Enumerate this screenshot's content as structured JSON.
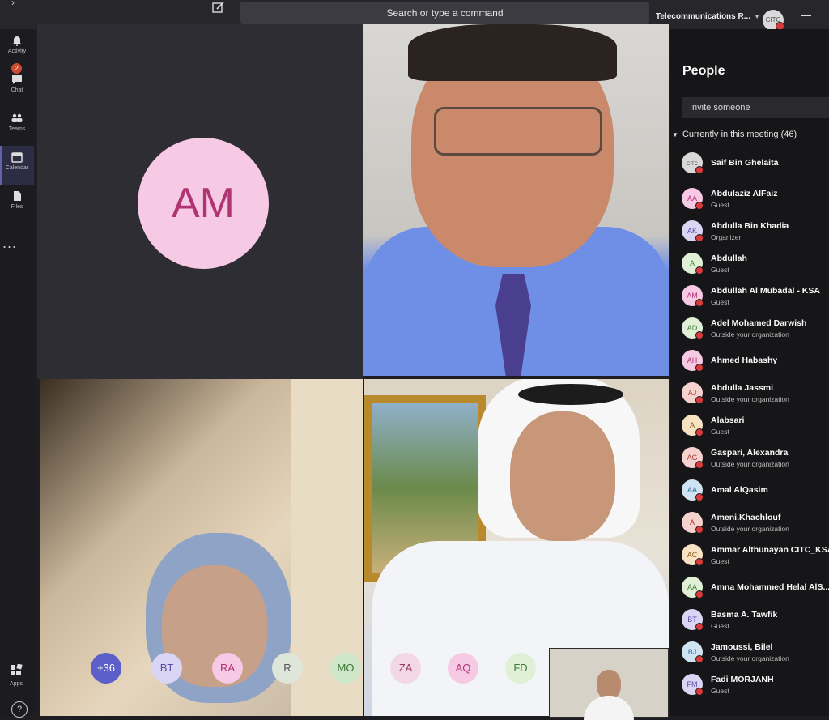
{
  "topbar": {
    "search_placeholder": "Search or type a command",
    "tenant": "Telecommunications R...",
    "me_initials": "CITC"
  },
  "rail": {
    "items": [
      {
        "label": "Activity"
      },
      {
        "label": "Chat",
        "badge": "2"
      },
      {
        "label": "Teams"
      },
      {
        "label": "Calendar"
      },
      {
        "label": "Files"
      }
    ],
    "more": "...",
    "apps": "Apps",
    "help": "?"
  },
  "stage": {
    "am_initials": "AM"
  },
  "roster": [
    {
      "initials": "+36",
      "bg": "#5b5fc7",
      "fg": "#ffffff"
    },
    {
      "initials": "BT",
      "bg": "#d9d5f3",
      "fg": "#5b4ba8"
    },
    {
      "initials": "RA",
      "bg": "#f6c9e4",
      "fg": "#b03473"
    },
    {
      "initials": "R",
      "bg": "#dde6d8",
      "fg": "#555555"
    },
    {
      "initials": "MO",
      "bg": "#cfe6c9",
      "fg": "#3d7a36"
    },
    {
      "initials": "ZA",
      "bg": "#f3d7e6",
      "fg": "#9b3a6a"
    },
    {
      "initials": "AQ",
      "bg": "#f6c9e4",
      "fg": "#b03473"
    },
    {
      "initials": "FD",
      "bg": "#dff0d6",
      "fg": "#3d7a36"
    }
  ],
  "people": {
    "title": "People",
    "invite_placeholder": "Invite someone",
    "section": "Currently in this meeting (46)",
    "list": [
      {
        "initials": "CITC",
        "name": "Saif Bin Ghelaita",
        "role": "",
        "bg": "#d9d9d9",
        "fg": "#555555"
      },
      {
        "initials": "AA",
        "name": "Abdulaziz AlFaiz",
        "role": "Guest",
        "bg": "#f6c9e4",
        "fg": "#b03473"
      },
      {
        "initials": "AK",
        "name": "Abdulla Bin Khadia",
        "role": "Organizer",
        "bg": "#d9d5f3",
        "fg": "#5b4ba8"
      },
      {
        "initials": "A",
        "name": "Abdullah",
        "role": "Guest",
        "bg": "#dff0d6",
        "fg": "#3d7a36"
      },
      {
        "initials": "AM",
        "name": "Abdullah Al Mubadal - KSA",
        "role": "Guest",
        "bg": "#f6c9e4",
        "fg": "#b03473"
      },
      {
        "initials": "AD",
        "name": "Adel Mohamed Darwish",
        "role": "Outside your organization",
        "bg": "#dff0d6",
        "fg": "#3d7a36"
      },
      {
        "initials": "AH",
        "name": "Ahmed Habashy",
        "role": "",
        "bg": "#f6c9e4",
        "fg": "#b03473"
      },
      {
        "initials": "AJ",
        "name": "Abdulla Jassmi",
        "role": "Outside your organization",
        "bg": "#f6d2cf",
        "fg": "#a23b33"
      },
      {
        "initials": "A",
        "name": "Alabsari",
        "role": "Guest",
        "bg": "#f7e3c4",
        "fg": "#8a5a12"
      },
      {
        "initials": "AG",
        "name": "Gaspari, Alexandra",
        "role": "Outside your organization",
        "bg": "#f6d2cf",
        "fg": "#a23b33"
      },
      {
        "initials": "AA",
        "name": "Amal AlQasim",
        "role": "",
        "bg": "#cfe3f3",
        "fg": "#2b6a9e"
      },
      {
        "initials": "A",
        "name": "Ameni.Khachlouf",
        "role": "Outside your organization",
        "bg": "#f6d2cf",
        "fg": "#a23b33"
      },
      {
        "initials": "AC",
        "name": "Ammar Althunayan CITC_KSA",
        "role": "Guest",
        "bg": "#f7e3c4",
        "fg": "#8a5a12"
      },
      {
        "initials": "AA",
        "name": "Amna Mohammed Helal AlS...",
        "role": "",
        "bg": "#dff0d6",
        "fg": "#3d7a36"
      },
      {
        "initials": "BT",
        "name": "Basma A. Tawfik",
        "role": "Guest",
        "bg": "#d9d5f3",
        "fg": "#5b4ba8"
      },
      {
        "initials": "BJ",
        "name": "Jamoussi, Bilel",
        "role": "Outside your organization",
        "bg": "#cfe3f3",
        "fg": "#2b6a9e"
      },
      {
        "initials": "FM",
        "name": "Fadi MORJANH",
        "role": "Guest",
        "bg": "#d9d5f3",
        "fg": "#5b4ba8"
      }
    ]
  }
}
